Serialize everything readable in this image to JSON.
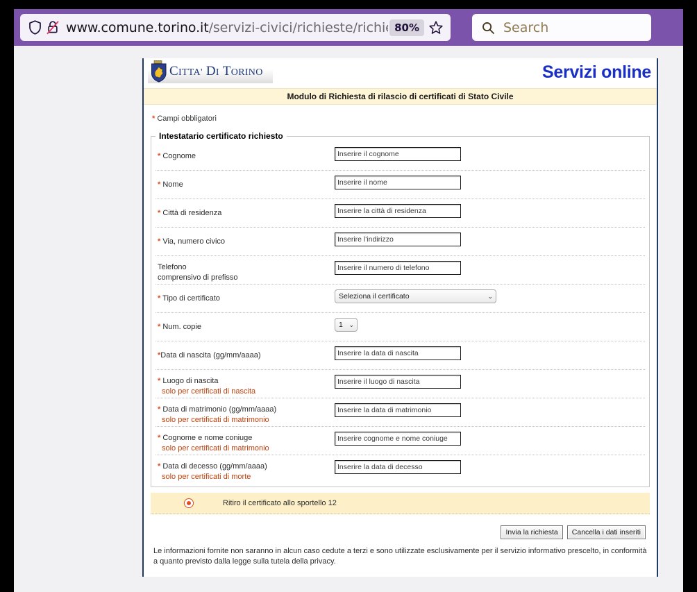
{
  "browser": {
    "url_main": "www.comune.torino.it",
    "url_path": "/servizi-civici/richieste/richies",
    "zoom_level": "80%",
    "search_placeholder": "Search",
    "icons": {
      "shield": "shield-icon",
      "lock_crossed": "lock-crossed-icon",
      "bookmark_star": "star-icon",
      "search": "search-icon"
    }
  },
  "site": {
    "logo_text_prefix": "C",
    "logo_text_1": "ITTA' ",
    "logo_text_2": "D",
    "logo_text_3": "I ",
    "logo_text_4": "T",
    "logo_text_5": "ORINO",
    "logo_alt": "Citta' di Torino",
    "servizi_online": "Servizi online",
    "banner_title": "Modulo di Richiesta di rilascio di certificati di Stato Civile"
  },
  "form": {
    "required_note": "Campi obbligatori",
    "fieldset_legend": "Intestatario certificato richiesto",
    "rows": [
      {
        "label": "Cognome",
        "required": true,
        "sub": "",
        "control": "text",
        "placeholder": "Inserire il cognome",
        "value": "",
        "name": "cognome"
      },
      {
        "label": "Nome",
        "required": true,
        "sub": "",
        "control": "text",
        "placeholder": "Inserire il nome",
        "value": "",
        "name": "nome"
      },
      {
        "label": "Città di residenza",
        "required": true,
        "sub": "",
        "control": "text",
        "placeholder": "Inserire la città di residenza",
        "value": "",
        "name": "citta-residenza"
      },
      {
        "label": "Via, numero civico",
        "required": true,
        "sub": "",
        "control": "text",
        "placeholder": "Inserire l'indirizzo",
        "value": "",
        "name": "via-numero-civico"
      },
      {
        "label": "Telefono",
        "required": false,
        "sub": "comprensivo di prefisso",
        "sub_style": "plain",
        "control": "text",
        "placeholder": "Inserire il numero di telefono",
        "value": "",
        "name": "telefono"
      },
      {
        "label": "Tipo di certificato",
        "required": true,
        "sub": "",
        "control": "select-wide",
        "selected": "Seleziona il certificato",
        "name": "tipo-certificato"
      },
      {
        "label": "Num. copie",
        "required": true,
        "sub": "",
        "control": "select-narrow",
        "selected": "1",
        "name": "num-copie"
      },
      {
        "label": "Data di nascita (gg/mm/aaaa)",
        "required": true,
        "required_nospace": true,
        "sub": "",
        "control": "text",
        "placeholder": "Inserire la data di nascita",
        "value": "",
        "name": "data-nascita"
      },
      {
        "label": "Luogo di nascita",
        "required": true,
        "sub": "solo per certificati di nascita",
        "control": "text",
        "placeholder": "Inserire il luogo di nascita",
        "value": "",
        "name": "luogo-nascita"
      },
      {
        "label": "Data di matrimonio (gg/mm/aaaa)",
        "required": true,
        "sub": "solo per certificati di matrimonio",
        "control": "text",
        "placeholder": "Inserire la data di matrimonio",
        "value": "",
        "name": "data-matrimonio"
      },
      {
        "label": "Cognome e nome coniuge",
        "required": true,
        "sub": "solo per certificati di matrimonio",
        "control": "text",
        "placeholder": "Inserire cognome e nome coniuge",
        "value": "",
        "name": "cognome-nome-coniuge"
      },
      {
        "label": "Data di decesso (gg/mm/aaaa)",
        "required": true,
        "sub": "solo per certificati di morte",
        "control": "text",
        "placeholder": "Inserire la data di decesso",
        "value": "",
        "name": "data-decesso"
      }
    ],
    "ritiro_label": "Ritiro il certificato allo sportello 12",
    "ritiro_selected": true,
    "submit_label": "Invia la richiesta",
    "reset_label": "Cancella i dati inseriti",
    "privacy_text": "Le informazioni fornite non saranno in alcun caso cedute a terzi e sono utilizzate esclusivamente per il servizio informativo prescelto, in conformità a quanto previsto dalla legge sulla tutela della privacy."
  },
  "colors": {
    "chrome_purple": "#7b53aa",
    "banner_cream": "#fdf5d6",
    "brand_blue": "#1a2fc4",
    "required_orange": "#d8501e",
    "border_navy": "#1f3864"
  }
}
